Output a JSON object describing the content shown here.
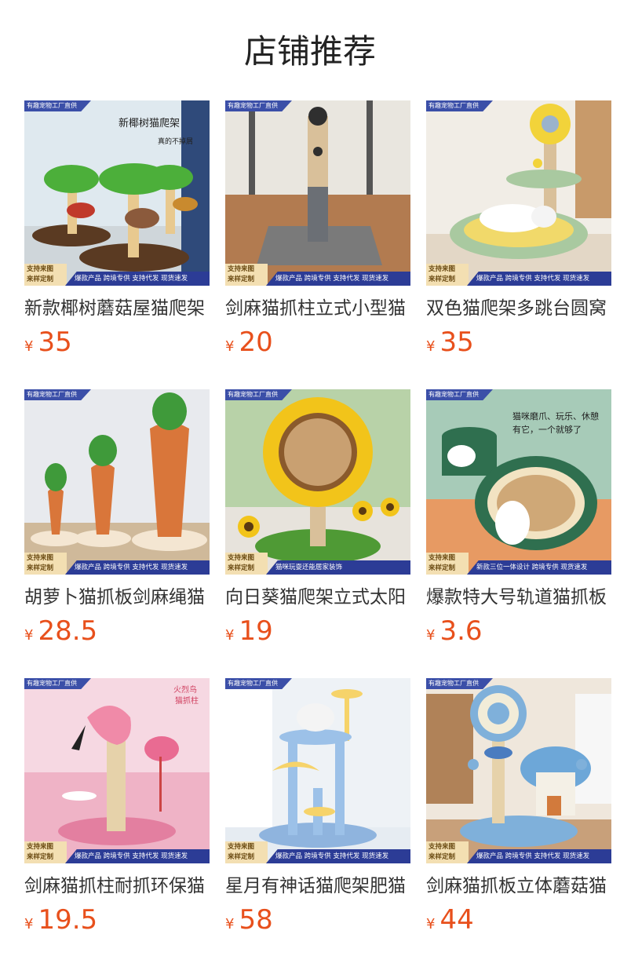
{
  "page": {
    "title": "店铺推荐"
  },
  "colors": {
    "price": "#e8501c",
    "badge_blue": "#2c3c96",
    "badge_gold": "#f3dfb2"
  },
  "products": [
    {
      "name": "新款椰树蘑菇屋猫爬架",
      "currency": "¥",
      "price": "35",
      "badge_top": "有趣宠物工厂直供",
      "badge_left_1": "支持来图",
      "badge_left_2": "来样定制",
      "badge_bar": "爆款产品 跨境专供 支持代发 现货速发",
      "image": "coconut-tree-mushroom-cat-tree",
      "overlay_1": "新椰树猫爬架",
      "overlay_2": "真的不掉屑",
      "overlay_3": ""
    },
    {
      "name": "剑麻猫抓柱立式小型猫",
      "currency": "¥",
      "price": "20",
      "badge_top": "有趣宠物工厂直供",
      "badge_left_1": "支持来图",
      "badge_left_2": "来样定制",
      "badge_bar": "爆款产品 跨境专供 支持代发 现货速发",
      "image": "sisal-scratching-post",
      "overlay_1": "",
      "overlay_2": "",
      "overlay_3": ""
    },
    {
      "name": "双色猫爬架多跳台圆窝",
      "currency": "¥",
      "price": "35",
      "badge_top": "有趣宠物工厂直供",
      "badge_left_1": "支持来图",
      "badge_left_2": "来样定制",
      "badge_bar": "爆款产品 跨境专供 支持代发 现货速发",
      "image": "flower-cat-tree-with-bed",
      "overlay_1": "",
      "overlay_2": "",
      "overlay_3": ""
    },
    {
      "name": "胡萝卜猫抓板剑麻绳猫",
      "currency": "¥",
      "price": "28.5",
      "badge_top": "有趣宠物工厂直供",
      "badge_left_1": "支持来图",
      "badge_left_2": "来样定制",
      "badge_bar": "爆款产品 跨境专供 支持代发 现货速发",
      "image": "carrot-scratching-posts",
      "overlay_1": "",
      "overlay_2": "",
      "overlay_3": ""
    },
    {
      "name": "向日葵猫爬架立式太阳",
      "currency": "¥",
      "price": "19",
      "badge_top": "有趣宠物工厂直供",
      "badge_left_1": "支持来图",
      "badge_left_2": "来样定制",
      "badge_bar": "猫咪玩耍还能居家装饰",
      "image": "sunflower-scratching-post",
      "overlay_1": "",
      "overlay_2": "",
      "overlay_3": ""
    },
    {
      "name": "爆款特大号轨道猫抓板",
      "currency": "¥",
      "price": "3.6",
      "badge_top": "有趣宠物工厂直供",
      "badge_left_1": "支持来图",
      "badge_left_2": "来样定制",
      "badge_bar": "新款三位一体设计 跨境专供 现货速发",
      "image": "track-scratching-board",
      "overlay_1": "猫咪磨爪、玩乐、休憩",
      "overlay_2": "有它，一个就够了",
      "overlay_3": ""
    },
    {
      "name": "剑麻猫抓柱耐抓环保猫",
      "currency": "¥",
      "price": "19.5",
      "badge_top": "有趣宠物工厂直供",
      "badge_left_1": "支持来图",
      "badge_left_2": "来样定制",
      "badge_bar": "爆款产品 跨境专供 支持代发 现货速发",
      "image": "flamingo-scratching-post",
      "overlay_1": "火烈鸟",
      "overlay_2": "猫抓柱",
      "overlay_3": ""
    },
    {
      "name": "星月有神话猫爬架肥猫",
      "currency": "¥",
      "price": "58",
      "badge_top": "有趣宠物工厂直供",
      "badge_left_1": "支持来图",
      "badge_left_2": "来样定制",
      "badge_bar": "爆款产品 跨境专供 支持代发 现货速发",
      "image": "star-moon-cat-tree",
      "overlay_1": "",
      "overlay_2": "",
      "overlay_3": ""
    },
    {
      "name": "剑麻猫抓板立体蘑菇猫",
      "currency": "¥",
      "price": "44",
      "badge_top": "有趣宠物工厂直供",
      "badge_left_1": "支持来图",
      "badge_left_2": "来样定制",
      "badge_bar": "爆款产品 跨境专供 支持代发 现货速发",
      "image": "lollipop-mushroom-scratching-post",
      "overlay_1": "",
      "overlay_2": "",
      "overlay_3": ""
    }
  ]
}
